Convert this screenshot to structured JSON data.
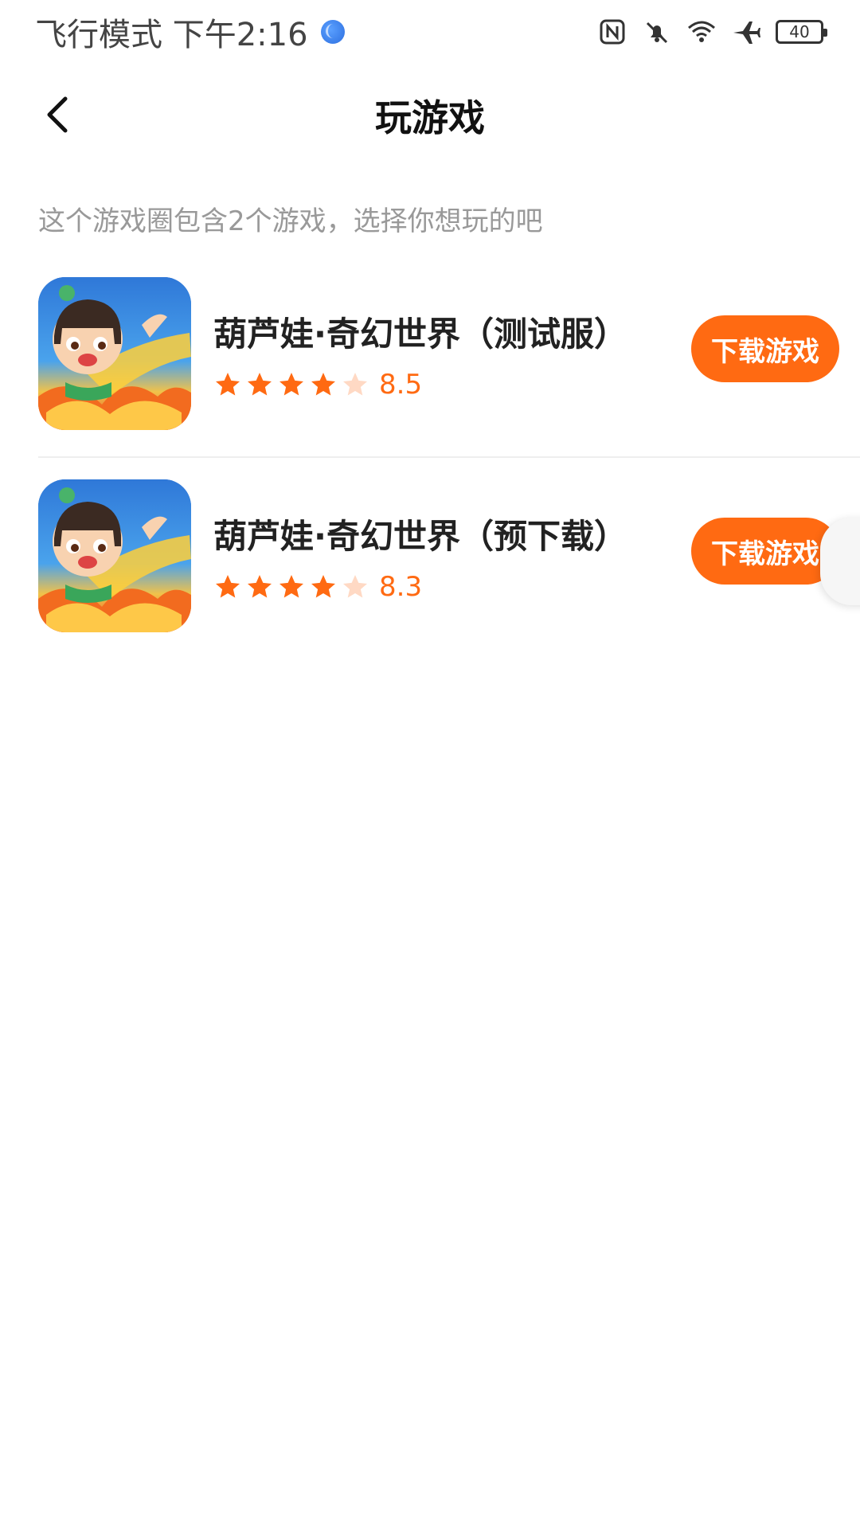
{
  "status_bar": {
    "left_text": "飞行模式 下午2:16",
    "battery_level": "40",
    "icons": [
      "globe-icon",
      "nfc-icon",
      "bell-off-icon",
      "wifi-icon",
      "airplane-icon",
      "battery-icon"
    ]
  },
  "header": {
    "title": "玩游戏",
    "back_icon": "chevron-left-icon"
  },
  "subtitle": "这个游戏圈包含2个游戏，选择你想玩的吧",
  "games": [
    {
      "name": "葫芦娃·奇幻世界（测试服）",
      "rating_stars_filled": 4,
      "rating_stars_total": 5,
      "score": "8.5",
      "button_label": "下载游戏"
    },
    {
      "name": "葫芦娃·奇幻世界（预下载）",
      "rating_stars_filled": 4,
      "rating_stars_total": 5,
      "score": "8.3",
      "button_label": "下载游戏"
    }
  ],
  "colors": {
    "accent": "#ff6a12",
    "star_filled": "#ff6a12",
    "star_empty": "#ffd9c4"
  }
}
